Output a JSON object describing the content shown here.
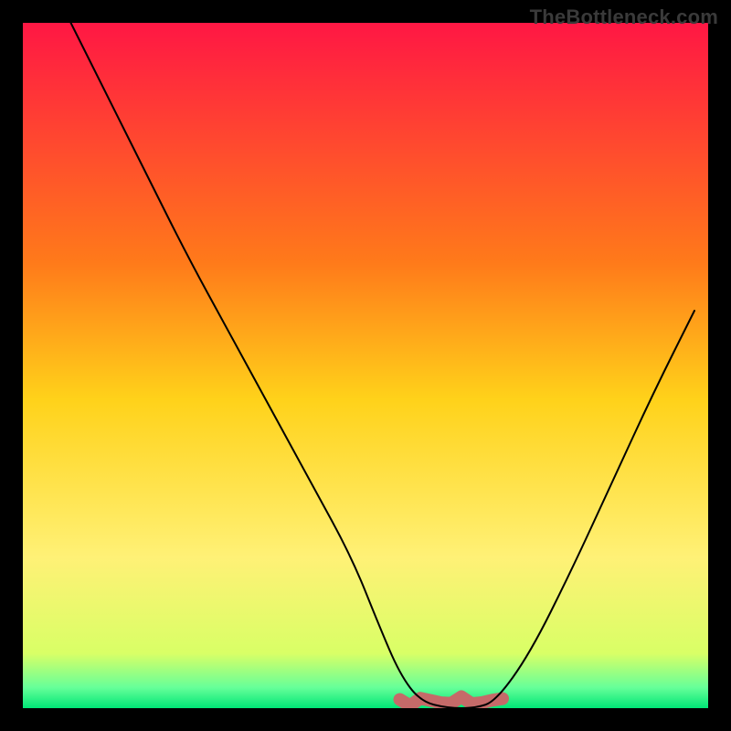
{
  "watermark": {
    "text": "TheBottleneck.com"
  },
  "chart_data": {
    "type": "line",
    "title": "",
    "xlabel": "",
    "ylabel": "",
    "xlim": [
      0,
      100
    ],
    "ylim": [
      0,
      100
    ],
    "grid": false,
    "legend": false,
    "background_gradient": {
      "stops": [
        {
          "offset": 0.0,
          "color": "#ff1744"
        },
        {
          "offset": 0.35,
          "color": "#ff7a1a"
        },
        {
          "offset": 0.55,
          "color": "#ffd21a"
        },
        {
          "offset": 0.78,
          "color": "#fff176"
        },
        {
          "offset": 0.92,
          "color": "#d9ff66"
        },
        {
          "offset": 0.97,
          "color": "#66ff99"
        },
        {
          "offset": 1.0,
          "color": "#00e676"
        }
      ]
    },
    "series": [
      {
        "name": "bottleneck-curve",
        "x": [
          7,
          12,
          18,
          24,
          30,
          36,
          42,
          48,
          52,
          55,
          58,
          62,
          66,
          69,
          74,
          80,
          86,
          92,
          98
        ],
        "y": [
          100,
          90,
          78,
          66,
          55,
          44,
          33,
          22,
          12,
          5,
          1,
          0,
          0,
          1,
          8,
          20,
          33,
          46,
          58
        ]
      }
    ],
    "floor_band": {
      "color": "#c56a69",
      "x_start": 55,
      "x_end": 70,
      "y": 1
    }
  }
}
